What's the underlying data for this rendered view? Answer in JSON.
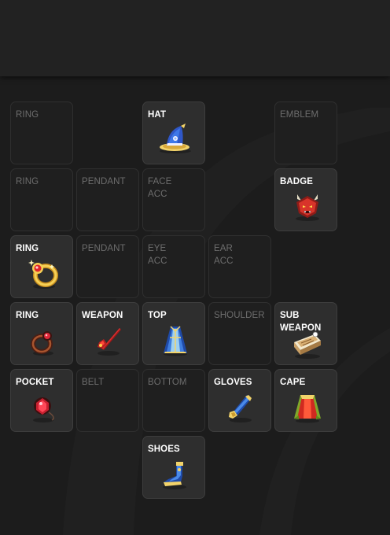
{
  "equipment": {
    "slots": [
      {
        "id": "ring-1",
        "label": "RING",
        "filled": false
      },
      {
        "id": "hat",
        "label": "HAT",
        "filled": true,
        "icon": "wizard-hat-icon"
      },
      {
        "id": "emblem",
        "label": "EMBLEM",
        "filled": false
      },
      {
        "id": "ring-2",
        "label": "RING",
        "filled": false
      },
      {
        "id": "pendant-1",
        "label": "PENDANT",
        "filled": false
      },
      {
        "id": "face-acc",
        "label": "FACE\nACC",
        "filled": false
      },
      {
        "id": "badge",
        "label": "BADGE",
        "filled": true,
        "icon": "demon-badge-icon"
      },
      {
        "id": "ring-3",
        "label": "RING",
        "filled": true,
        "icon": "gold-ring-icon"
      },
      {
        "id": "pendant-2",
        "label": "PENDANT",
        "filled": false
      },
      {
        "id": "eye-acc",
        "label": "EYE\nACC",
        "filled": false
      },
      {
        "id": "ear-acc",
        "label": "EAR\nACC",
        "filled": false
      },
      {
        "id": "ring-4",
        "label": "RING",
        "filled": true,
        "icon": "red-gem-ring-icon"
      },
      {
        "id": "weapon",
        "label": "WEAPON",
        "filled": true,
        "icon": "red-staff-icon"
      },
      {
        "id": "top",
        "label": "TOP",
        "filled": true,
        "icon": "blue-robe-icon"
      },
      {
        "id": "shoulder",
        "label": "SHOULDER",
        "filled": false
      },
      {
        "id": "sub-weapon",
        "label": "SUB\nWEAPON",
        "filled": true,
        "icon": "spellbook-icon"
      },
      {
        "id": "pocket",
        "label": "POCKET",
        "filled": true,
        "icon": "red-gem-orb-icon"
      },
      {
        "id": "belt",
        "label": "BELT",
        "filled": false
      },
      {
        "id": "bottom",
        "label": "BOTTOM",
        "filled": false
      },
      {
        "id": "gloves",
        "label": "GLOVES",
        "filled": true,
        "icon": "gloves-icon"
      },
      {
        "id": "cape",
        "label": "CAPE",
        "filled": true,
        "icon": "cape-icon"
      },
      {
        "id": "shoes",
        "label": "SHOES",
        "filled": true,
        "icon": "blue-shoe-icon"
      }
    ]
  },
  "colors": {
    "background": "#1c1c1c",
    "slot_empty": "#1f1f1f",
    "slot_filled": "#2e2e2e",
    "label_empty": "#6d6d6d",
    "label_filled": "#ffffff"
  }
}
